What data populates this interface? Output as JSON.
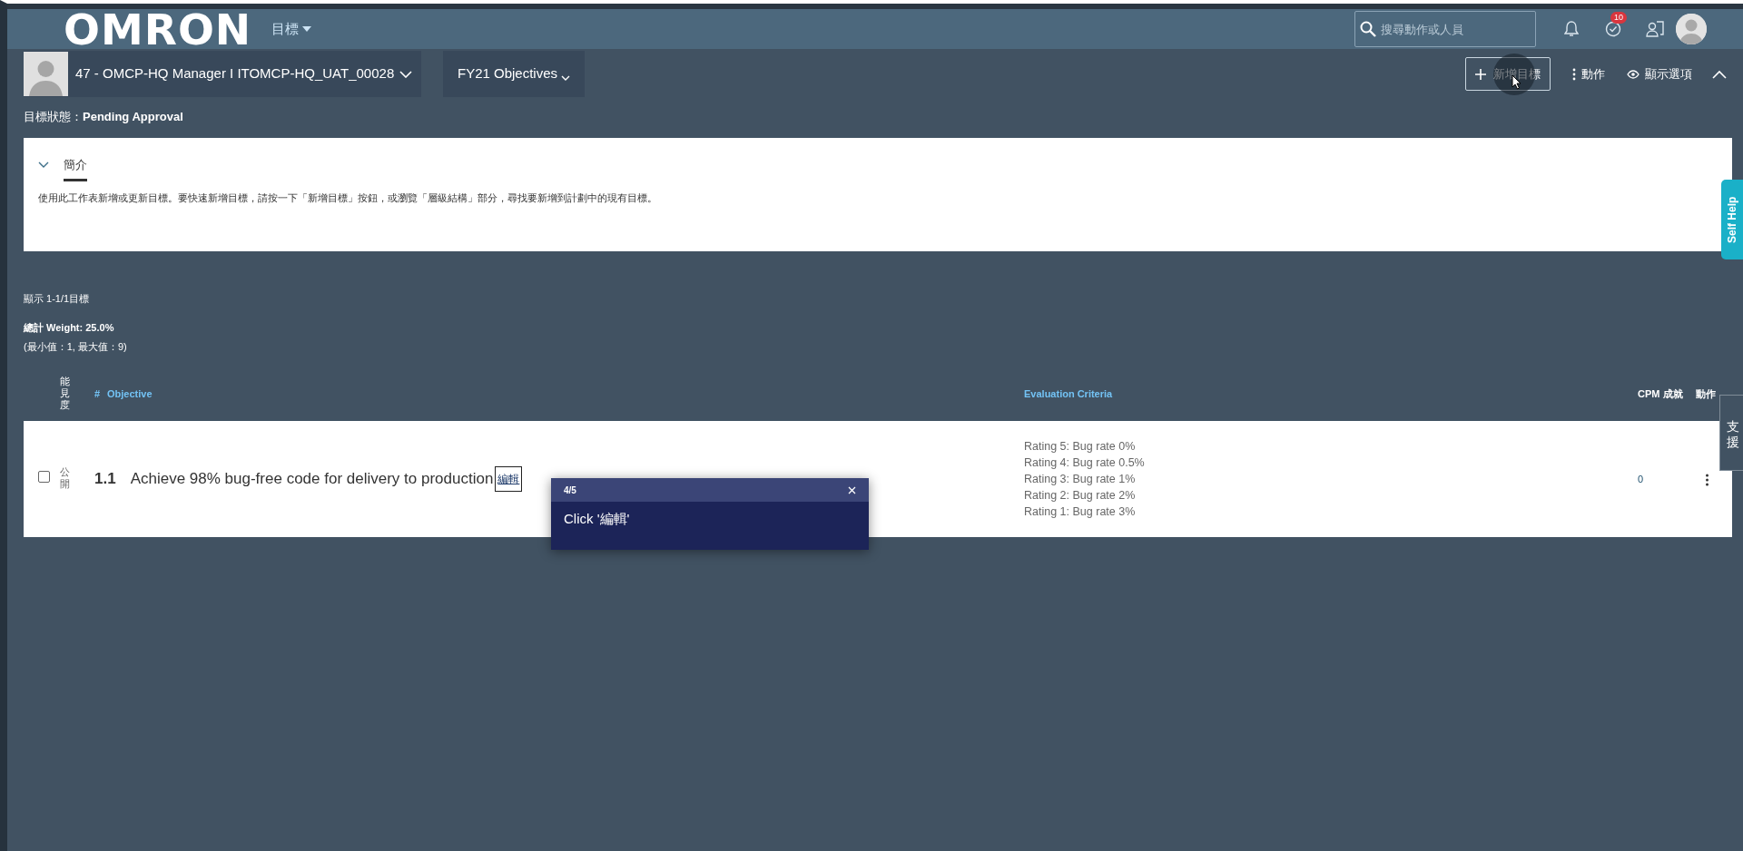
{
  "header": {
    "logo": "OMRON",
    "menu": "目標",
    "search": {
      "placeholder": "搜尋動作或人員"
    },
    "notification_count": "10"
  },
  "toolbar": {
    "person": "47 - OMCP-HQ Manager I ITOMCP-HQ_UAT_00028",
    "plan": "FY21 Objectives",
    "actions": [
      {
        "kind": "add",
        "label": "新增目標"
      },
      {
        "kind": "more",
        "label": "動作"
      },
      {
        "kind": "view",
        "label": "顯示選項"
      }
    ]
  },
  "status": {
    "label": "目標狀態：",
    "value": "Pending Approval"
  },
  "intro": {
    "tab": "簡介",
    "expanded": true,
    "text": "使用此工作表新增或更新目標。要快速新增目標，請按一下「新增目標」按鈕，或瀏覽「層級結構」部分，尋找要新增到計劃中的現有目標。"
  },
  "summary": {
    "showing": "顯示 1-1/1目標",
    "total_weight": "總計 Weight: 25.0%",
    "range": "(最小值：1, 最大值：9)"
  },
  "table": {
    "columns": [
      "能見度",
      "#",
      "Objective",
      "Evaluation Criteria",
      "CPM 成就",
      "動作"
    ],
    "rows": [
      {
        "checked": false,
        "visibility": "公開",
        "number": "1.1",
        "objective": "Achieve 98% bug-free code for delivery to production",
        "edit_link": "編輯",
        "criteria": [
          "Rating 5: Bug rate 0%",
          "Rating 4: Bug rate 0.5%",
          "Rating 3: Bug rate 1%",
          "Rating 2: Bug rate 2%",
          "Rating 1: Bug rate 3%"
        ],
        "cpm": "0"
      }
    ]
  },
  "tooltip": {
    "step": "4/5",
    "text": "Click '編輯'"
  },
  "side_tabs": [
    "Self Help",
    "支援"
  ]
}
